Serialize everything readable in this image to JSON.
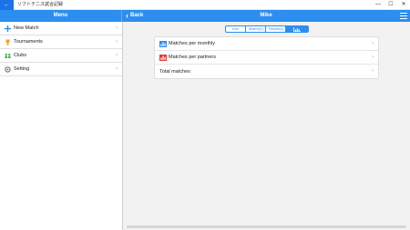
{
  "window": {
    "back_glyph": "←",
    "title": "ソフトテニス試合記録",
    "minimize_glyph": "—",
    "maximize_glyph": "☐",
    "close_glyph": "✕"
  },
  "appbar": {
    "menu_title": "Menu",
    "back_label": "Back",
    "page_title": "Mike"
  },
  "sidebar": {
    "items": [
      {
        "label": "New Match",
        "icon": "plus-icon",
        "color": "#2b8ef0"
      },
      {
        "label": "Tournaments",
        "icon": "trophy-icon",
        "color": "#f0a020"
      },
      {
        "label": "Clubs",
        "icon": "people-icon",
        "color": "#3aa83a"
      },
      {
        "label": "Setting",
        "icon": "gear-icon",
        "color": "#666666"
      }
    ]
  },
  "tabs": {
    "items": [
      "Info",
      "Match(2)",
      "Result(1)"
    ],
    "active": "chart-tab"
  },
  "charts_list": {
    "items": [
      {
        "label": "Matches per monthly",
        "icon": "bar-chart-icon",
        "color": "#2b8ef0"
      },
      {
        "label": "Matches per partners",
        "icon": "bar-chart-icon",
        "color": "#e53935"
      },
      {
        "label": "Total matches",
        "icon": "",
        "color": ""
      }
    ]
  },
  "colors": {
    "accent": "#2b8ef0",
    "background": "#f2f2f2"
  }
}
